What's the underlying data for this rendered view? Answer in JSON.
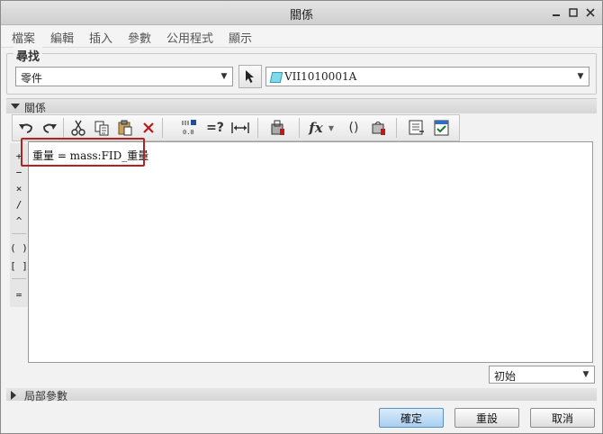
{
  "window": {
    "title": "關係"
  },
  "menu": {
    "items": [
      "檔案",
      "編輯",
      "插入",
      "參數",
      "公用程式",
      "顯示"
    ]
  },
  "find": {
    "label": "尋找",
    "type_value": "零件",
    "model_value": "VII1010001A"
  },
  "relations": {
    "header": "關係",
    "text": "重量 = mass:FID_重量",
    "mode_value": "初始"
  },
  "toolbar": {
    "eval_label": "=?",
    "func_label": "fx",
    "paren_label": "()"
  },
  "operators": [
    "+",
    "−",
    "×",
    "/",
    "^",
    "( )",
    "[ ]",
    "="
  ],
  "local": {
    "header": "局部參數"
  },
  "buttons": {
    "ok": "確定",
    "reset": "重設",
    "cancel": "取消"
  },
  "colors": {
    "highlight": "#b22222",
    "primary_button": "#a9cff0"
  }
}
